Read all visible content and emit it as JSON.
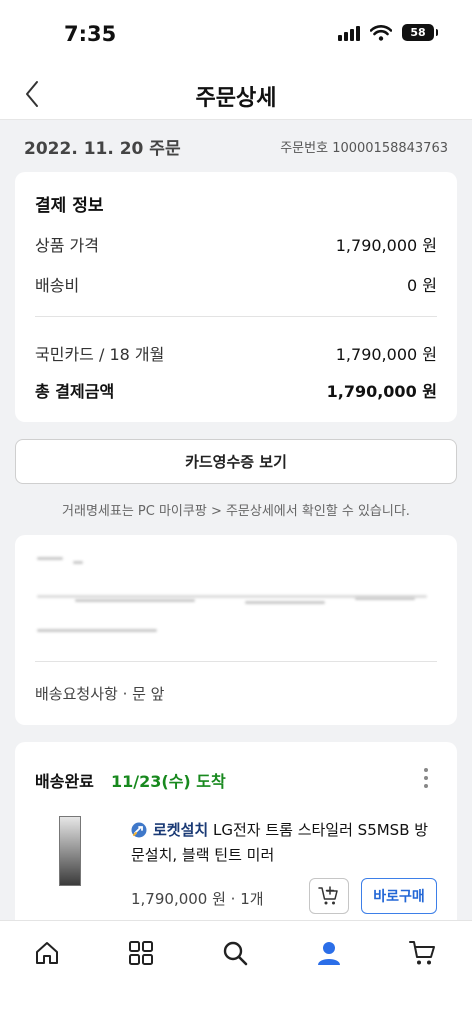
{
  "status_bar": {
    "time": "7:35",
    "battery": "58"
  },
  "header": {
    "title": "주문상세"
  },
  "order": {
    "date": "2022. 11. 20 주문",
    "number": "주문번호 10000158843763"
  },
  "payment": {
    "title": "결제 정보",
    "product_price_label": "상품 가격",
    "product_price_value": "1,790,000 원",
    "shipping_label": "배송비",
    "shipping_value": "0 원",
    "card_label": "국민카드 / 18 개월",
    "card_value": "1,790,000 원",
    "total_label": "총 결제금액",
    "total_value": "1,790,000 원"
  },
  "receipt_button": "카드영수증 보기",
  "notice": "거래명세표는 PC 마이쿠팡 > 주문상세에서 확인할 수 있습니다.",
  "address": {
    "delivery_request": "배송요청사항 · 문 앞"
  },
  "shipment": {
    "status": "배송완료",
    "arrival": "11/23(수) 도착",
    "badge": "로켓설치",
    "product_name": "LG전자 트롬 스타일러 S5MSB 방문설치, 블랙 틴트 미러",
    "price_qty": "1,790,000 원 · 1개",
    "buy_button": "바로구매"
  },
  "tabs": [
    "home-icon",
    "category-grid-icon",
    "search-icon",
    "my-page-icon",
    "cart-icon"
  ],
  "colors": {
    "accent_blue": "#2367d6",
    "arrival_green": "#18891e",
    "active_tab": "#2b6ee8"
  }
}
